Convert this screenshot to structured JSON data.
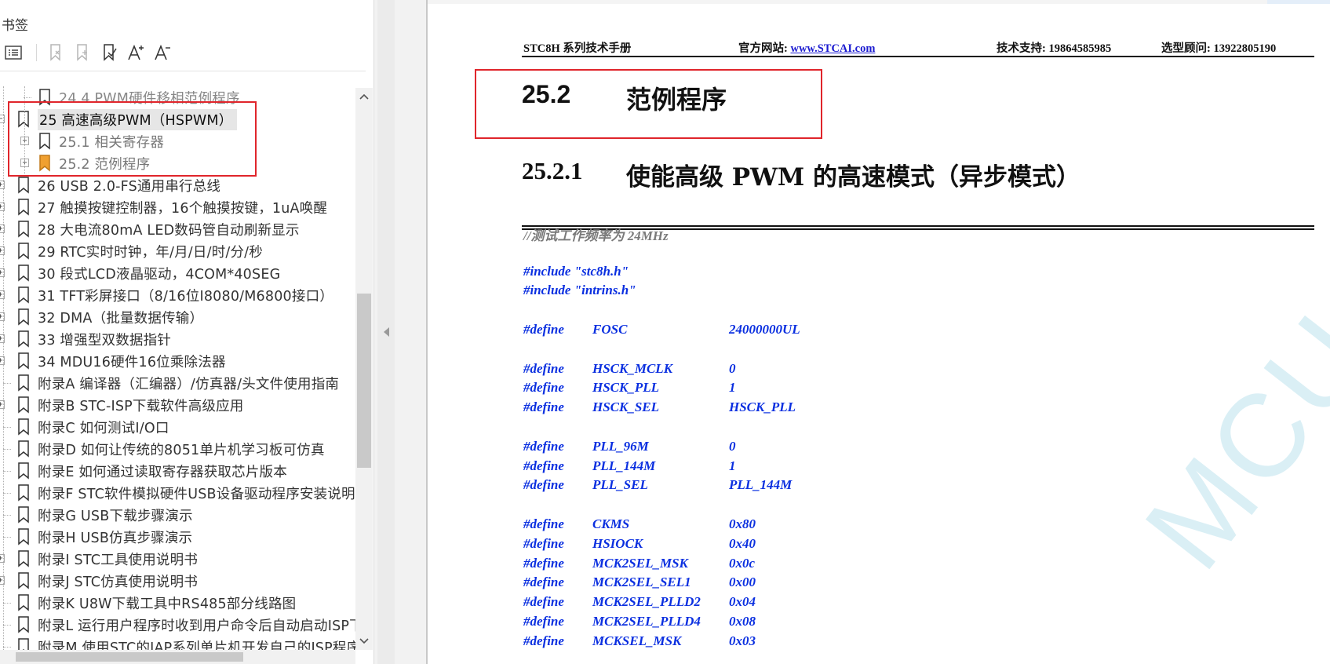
{
  "sidebar": {
    "title": "书签",
    "toolbar": {
      "buttons": [
        {
          "name": "bookmark-list-icon"
        },
        {
          "name": "expand-bookmark-icon"
        },
        {
          "name": "collapse-bookmark-icon"
        },
        {
          "name": "find-current-bookmark-icon"
        },
        {
          "name": "increase-font-icon"
        },
        {
          "name": "decrease-font-icon"
        }
      ]
    },
    "items": [
      {
        "label": "24.4  PWM硬件移相范例程序",
        "level": 2,
        "expandable": false,
        "state": "faded"
      },
      {
        "label": "25  高速高级PWM（HSPWM）",
        "level": 1,
        "expandable": true,
        "state": "selected"
      },
      {
        "label": "25.1 相关寄存器",
        "level": 2,
        "expandable": true,
        "state": "sub"
      },
      {
        "label": "25.2  范例程序",
        "level": 2,
        "expandable": true,
        "state": "sub-current"
      },
      {
        "label": "26  USB 2.0-FS通用串行总线",
        "level": 1,
        "expandable": true,
        "state": "normal"
      },
      {
        "label": "27  触摸按键控制器，16个触摸按键，1uA唤醒",
        "level": 1,
        "expandable": true,
        "state": "normal"
      },
      {
        "label": "28  大电流80mA  LED数码管自动刷新显示",
        "level": 1,
        "expandable": true,
        "state": "normal"
      },
      {
        "label": "29  RTC实时时钟，年/月/日/时/分/秒",
        "level": 1,
        "expandable": true,
        "state": "normal"
      },
      {
        "label": "30  段式LCD液晶驱动，4COM*40SEG",
        "level": 1,
        "expandable": true,
        "state": "normal"
      },
      {
        "label": "31  TFT彩屏接口（8/16位I8080/M6800接口）",
        "level": 1,
        "expandable": true,
        "state": "normal"
      },
      {
        "label": "32  DMA（批量数据传输）",
        "level": 1,
        "expandable": true,
        "state": "normal"
      },
      {
        "label": "33  增强型双数据指针",
        "level": 1,
        "expandable": true,
        "state": "normal"
      },
      {
        "label": "34  MDU16硬件16位乘除法器",
        "level": 1,
        "expandable": true,
        "state": "normal"
      },
      {
        "label": "附录A  编译器（汇编器）/仿真器/头文件使用指南",
        "level": 1,
        "expandable": false,
        "state": "normal"
      },
      {
        "label": "附录B  STC-ISP下载软件高级应用",
        "level": 1,
        "expandable": true,
        "state": "normal"
      },
      {
        "label": "附录C  如何测试I/O口",
        "level": 1,
        "expandable": false,
        "state": "normal"
      },
      {
        "label": "附录D  如何让传统的8051单片机学习板可仿真",
        "level": 1,
        "expandable": false,
        "state": "normal"
      },
      {
        "label": "附录E  如何通过读取寄存器获取芯片版本",
        "level": 1,
        "expandable": false,
        "state": "normal"
      },
      {
        "label": "附录F  STC软件模拟硬件USB设备驱动程序安装说明",
        "level": 1,
        "expandable": false,
        "state": "normal"
      },
      {
        "label": "附录G  USB下载步骤演示",
        "level": 1,
        "expandable": false,
        "state": "normal"
      },
      {
        "label": "附录H  USB仿真步骤演示",
        "level": 1,
        "expandable": false,
        "state": "normal"
      },
      {
        "label": "附录I  STC工具使用说明书",
        "level": 1,
        "expandable": true,
        "state": "normal"
      },
      {
        "label": "附录J  STC仿真使用说明书",
        "level": 1,
        "expandable": true,
        "state": "normal"
      },
      {
        "label": "附录K  U8W下载工具中RS485部分线路图",
        "level": 1,
        "expandable": false,
        "state": "normal"
      },
      {
        "label": "附录L  运行用户程序时收到用户命令后自动启动ISP下载",
        "level": 1,
        "expandable": false,
        "state": "normal"
      },
      {
        "label": "附录M  使用STC的IAP系列单片机开发自己的ISP程序",
        "level": 1,
        "expandable": false,
        "state": "normal"
      }
    ]
  },
  "document": {
    "header": {
      "manual": "STC8H 系列技术手册",
      "site_label": "官方网站: ",
      "site_link": "www.STCAI.com",
      "support": "技术支持: 19864585985",
      "consult": "选型顾问: 13922805190"
    },
    "section": {
      "number": "25.2",
      "title": "范例程序"
    },
    "subsection": {
      "number": "25.2.1",
      "title": "使能高级 PWM 的高速模式（异步模式）"
    },
    "code": [
      {
        "type": "comment",
        "text": "//测试工作频率为 24MHz"
      },
      {
        "type": "blank"
      },
      {
        "type": "include",
        "text": "#include \"stc8h.h\""
      },
      {
        "type": "include",
        "text": "#include \"intrins.h\""
      },
      {
        "type": "blank"
      },
      {
        "type": "define",
        "name": "FOSC",
        "value": "24000000UL"
      },
      {
        "type": "blank"
      },
      {
        "type": "define",
        "name": "HSCK_MCLK",
        "value": "0"
      },
      {
        "type": "define",
        "name": "HSCK_PLL",
        "value": "1"
      },
      {
        "type": "define",
        "name": "HSCK_SEL",
        "value": "HSCK_PLL"
      },
      {
        "type": "blank"
      },
      {
        "type": "define",
        "name": "PLL_96M",
        "value": "0"
      },
      {
        "type": "define",
        "name": "PLL_144M",
        "value": "1"
      },
      {
        "type": "define",
        "name": "PLL_SEL",
        "value": "PLL_144M"
      },
      {
        "type": "blank"
      },
      {
        "type": "define",
        "name": "CKMS",
        "value": "0x80"
      },
      {
        "type": "define",
        "name": "HSIOCK",
        "value": "0x40"
      },
      {
        "type": "define",
        "name": "MCK2SEL_MSK",
        "value": "0x0c"
      },
      {
        "type": "define",
        "name": "MCK2SEL_SEL1",
        "value": "0x00"
      },
      {
        "type": "define",
        "name": "MCK2SEL_PLLD2",
        "value": "0x04"
      },
      {
        "type": "define",
        "name": "MCK2SEL_PLLD4",
        "value": "0x08"
      },
      {
        "type": "define",
        "name": "MCKSEL_MSK",
        "value": "0x03"
      }
    ],
    "define_keyword": "#define",
    "watermark": "MCU"
  },
  "colors": {
    "highlight_box": "#e0252b",
    "code_blue": "#0a2fe0",
    "comment_gray": "#7a7a7a",
    "current_bookmark": "#f0a030",
    "link_blue": "#1a1ad0"
  }
}
